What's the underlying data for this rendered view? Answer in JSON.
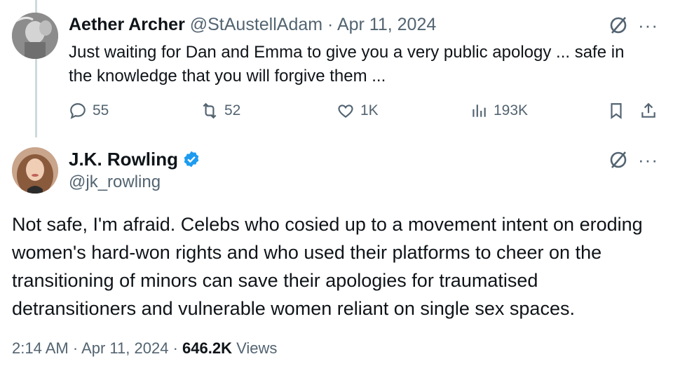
{
  "reply": {
    "author_name": "Aether Archer",
    "handle": "@StAustellAdam",
    "separator": "·",
    "date": "Apr 11, 2024",
    "text": "Just waiting for Dan and Emma to give you a very public apology ... safe in the knowledge that you will forgive them ...",
    "stats": {
      "replies": "55",
      "reposts": "52",
      "likes": "1K",
      "views": "193K"
    },
    "more_label": "···"
  },
  "main_post": {
    "author_name": "J.K. Rowling",
    "handle": "@jk_rowling",
    "text": "Not safe, I'm afraid. Celebs who cosied up to a movement intent on eroding women's hard-won rights and who used their platforms to cheer on the transitioning of minors can save their apologies for traumatised detransitioners and vulnerable women reliant on single sex spaces.",
    "time": "2:14 AM",
    "separator": "·",
    "date": "Apr 11, 2024",
    "views_count": "646.2K",
    "views_label": "Views",
    "more_label": "···"
  },
  "colors": {
    "text": "#0f1419",
    "muted": "#536471",
    "verified": "#1d9bf0",
    "thread_line": "#cfd9de"
  },
  "icons": [
    "reply-icon",
    "repost-icon",
    "like-icon",
    "views-icon",
    "bookmark-icon",
    "share-icon",
    "grok-icon",
    "more-icon",
    "verified-icon"
  ]
}
